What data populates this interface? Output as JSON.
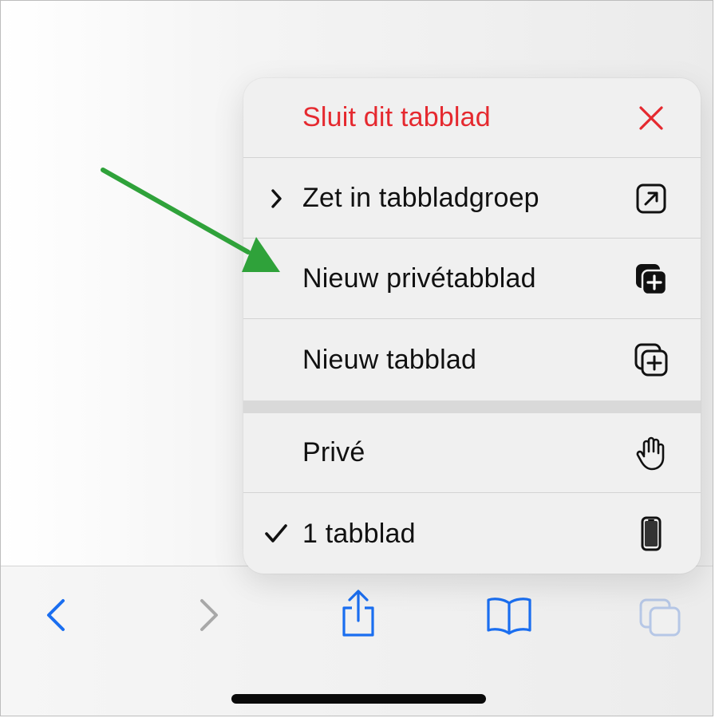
{
  "menu": {
    "items": [
      {
        "label": "Sluit dit tabblad",
        "lead": "",
        "icon": "close-x-icon",
        "destructive": true
      },
      {
        "label": "Zet in tabbladgroep",
        "lead": "chevron-right-icon",
        "icon": "move-to-group-icon"
      },
      {
        "label": "Nieuw privétabblad",
        "lead": "",
        "icon": "new-private-tab-icon"
      },
      {
        "label": "Nieuw tabblad",
        "lead": "",
        "icon": "new-tab-icon"
      },
      {
        "label": "Privé",
        "lead": "",
        "icon": "hand-icon"
      },
      {
        "label": "1 tabblad",
        "lead": "checkmark-icon",
        "icon": "iphone-icon",
        "selected": true
      }
    ]
  },
  "toolbar": {
    "buttons": [
      "back-icon",
      "forward-icon",
      "share-icon",
      "bookmarks-icon",
      "tabs-icon"
    ]
  },
  "colors": {
    "accent": "#1a6ef0",
    "destructive": "#e5292f",
    "annotation_arrow": "#2fa23a"
  }
}
